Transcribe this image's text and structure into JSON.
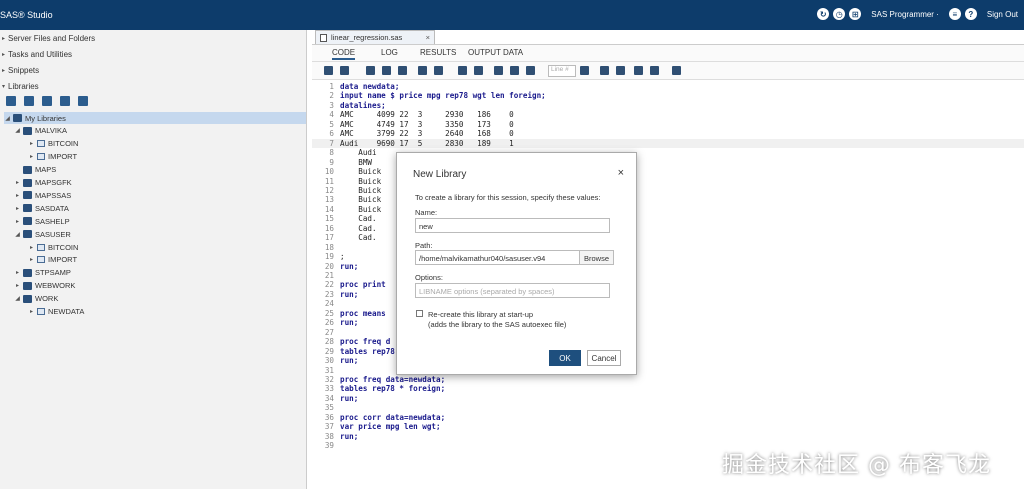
{
  "app": {
    "brand": "SAS® Studio"
  },
  "topbar": {
    "user_label": "SAS Programmer ·",
    "signout_label": "Sign Out"
  },
  "leftpanel": {
    "sections": [
      "Server Files and Folders",
      "Tasks and Utilities",
      "Snippets",
      "Libraries"
    ],
    "tree": [
      {
        "label": "My Libraries",
        "level": 0,
        "caret": "◢",
        "type": "libs"
      },
      {
        "label": "MALVIKA",
        "level": 1,
        "caret": "◢",
        "type": "lib"
      },
      {
        "label": "BITCOIN",
        "level": 2,
        "caret": "▸",
        "type": "tbl"
      },
      {
        "label": "IMPORT",
        "level": 2,
        "caret": "▸",
        "type": "tbl"
      },
      {
        "label": "MAPS",
        "level": 1,
        "caret": "",
        "type": "lib"
      },
      {
        "label": "MAPSGFK",
        "level": 1,
        "caret": "▸",
        "type": "lib"
      },
      {
        "label": "MAPSSAS",
        "level": 1,
        "caret": "▸",
        "type": "lib"
      },
      {
        "label": "SASDATA",
        "level": 1,
        "caret": "▸",
        "type": "lib"
      },
      {
        "label": "SASHELP",
        "level": 1,
        "caret": "▸",
        "type": "lib"
      },
      {
        "label": "SASUSER",
        "level": 1,
        "caret": "◢",
        "type": "lib"
      },
      {
        "label": "BITCOIN",
        "level": 2,
        "caret": "▸",
        "type": "tbl"
      },
      {
        "label": "IMPORT",
        "level": 2,
        "caret": "▸",
        "type": "tbl"
      },
      {
        "label": "STPSAMP",
        "level": 1,
        "caret": "▸",
        "type": "lib"
      },
      {
        "label": "WEBWORK",
        "level": 1,
        "caret": "▸",
        "type": "lib"
      },
      {
        "label": "WORK",
        "level": 1,
        "caret": "◢",
        "type": "lib"
      },
      {
        "label": "NEWDATA",
        "level": 2,
        "caret": "▸",
        "type": "tbl"
      }
    ]
  },
  "editor": {
    "file_tab": "linear_regression.sas",
    "tabs": [
      "CODE",
      "LOG",
      "RESULTS",
      "OUTPUT DATA"
    ],
    "line_placeholder": "Line #",
    "code": [
      {
        "n": "1",
        "t": "data newdata;"
      },
      {
        "n": "2",
        "t": "input name $ price mpg rep78 wgt len foreign;"
      },
      {
        "n": "3",
        "t": "datalines;"
      },
      {
        "n": "4",
        "t": "AMC     4099 22  3     2930   186    0"
      },
      {
        "n": "5",
        "t": "AMC     4749 17  3     3350   173    0"
      },
      {
        "n": "6",
        "t": "AMC     3799 22  3     2640   168    0"
      },
      {
        "n": "7",
        "t": "Audi    9690 17  5     2830   189    1"
      },
      {
        "n": "8",
        "t": "    Audi"
      },
      {
        "n": "9",
        "t": "    BMW"
      },
      {
        "n": "10",
        "t": "    Buick"
      },
      {
        "n": "11",
        "t": "    Buick"
      },
      {
        "n": "12",
        "t": "    Buick"
      },
      {
        "n": "13",
        "t": "    Buick"
      },
      {
        "n": "14",
        "t": "    Buick"
      },
      {
        "n": "15",
        "t": "    Cad."
      },
      {
        "n": "16",
        "t": "    Cad."
      },
      {
        "n": "17",
        "t": "    Cad."
      },
      {
        "n": "18",
        "t": ""
      },
      {
        "n": "19",
        "t": ";"
      },
      {
        "n": "20",
        "t": "run;"
      },
      {
        "n": "21",
        "t": ""
      },
      {
        "n": "22",
        "t": "proc print"
      },
      {
        "n": "23",
        "t": "run;"
      },
      {
        "n": "24",
        "t": ""
      },
      {
        "n": "25",
        "t": "proc means"
      },
      {
        "n": "26",
        "t": "run;"
      },
      {
        "n": "27",
        "t": ""
      },
      {
        "n": "28",
        "t": "proc freq d"
      },
      {
        "n": "29",
        "t": "tables rep78;"
      },
      {
        "n": "30",
        "t": "run;"
      },
      {
        "n": "31",
        "t": ""
      },
      {
        "n": "32",
        "t": "proc freq data=newdata;"
      },
      {
        "n": "33",
        "t": "tables rep78 * foreign;"
      },
      {
        "n": "34",
        "t": "run;"
      },
      {
        "n": "35",
        "t": ""
      },
      {
        "n": "36",
        "t": "proc corr data=newdata;"
      },
      {
        "n": "37",
        "t": "var price mpg len wgt;"
      },
      {
        "n": "38",
        "t": "run;"
      },
      {
        "n": "39",
        "t": ""
      }
    ]
  },
  "dialog": {
    "title": "New Library",
    "close": "×",
    "intro": "To create a library for this session, specify these values:",
    "name_label": "Name:",
    "name_value": "new",
    "path_label": "Path:",
    "path_value": "/home/malvikamathur040/sasuser.v94",
    "browse_label": "Browse",
    "options_label": "Options:",
    "options_placeholder": "LIBNAME options (separated by spaces)",
    "checkbox_label": "Re-create this library at start-up",
    "checkbox_sublabel": "(adds the library to the SAS autoexec file)",
    "ok_label": "OK",
    "cancel_label": "Cancel"
  },
  "watermark": "掘金技术社区 @ 布客飞龙",
  "colors": {
    "topbar": "#0d3c6b",
    "accent": "#1e4f7e",
    "selected": "#c5d8ee"
  }
}
